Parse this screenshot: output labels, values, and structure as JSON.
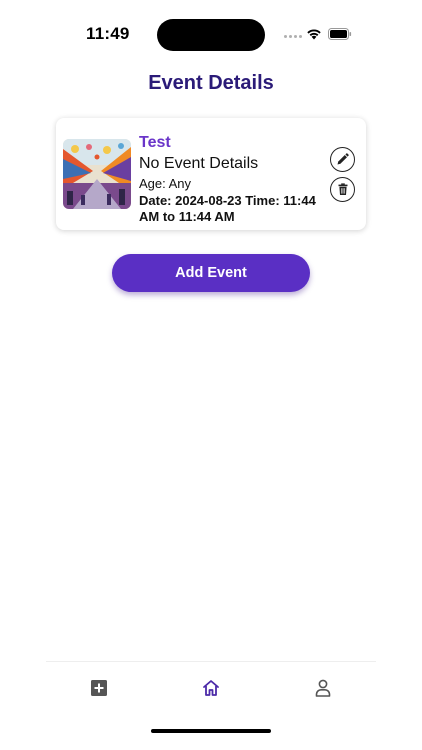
{
  "status_bar": {
    "time": "11:49"
  },
  "header": {
    "title": "Event Details"
  },
  "events": [
    {
      "name": "Test",
      "details": "No Event Details",
      "age": "Age: Any",
      "datetime": "Date: 2024-08-23 Time: 11:44\nAM  to  11:44 AM",
      "image_icon": "event-thumbnail",
      "actions": [
        "pencil-icon",
        "trash-icon"
      ]
    }
  ],
  "actions": {
    "add_event_label": "Add Event"
  },
  "tab_bar": {
    "tabs": [
      {
        "icon": "plus-square-icon",
        "active": false
      },
      {
        "icon": "home-icon",
        "active": true
      },
      {
        "icon": "person-icon",
        "active": false
      }
    ]
  },
  "colors": {
    "title": "#2b1b78",
    "accent": "#5a2fc4",
    "event_name": "#6a35c9",
    "active_tab": "#4b2aa8",
    "inactive_tab": "#555555"
  }
}
